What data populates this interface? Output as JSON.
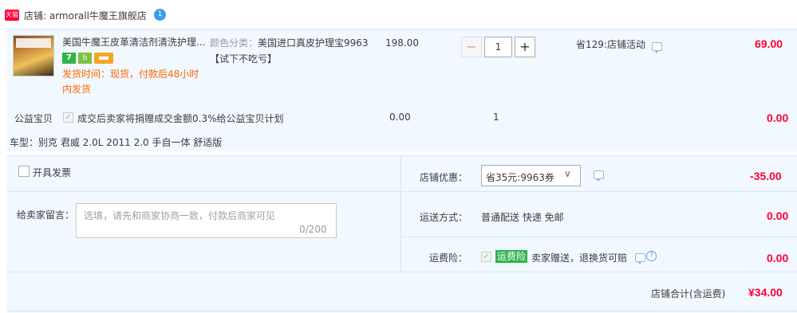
{
  "shop": {
    "badge": "天猫",
    "label": "店铺: armorall牛魔王旗舰店",
    "ww_icon_glyph": "1"
  },
  "item": {
    "title": "美国牛魔王皮革清洁剂清洗护理...",
    "badge_7": "7",
    "badge_b": "b",
    "delivery": "发货时间：现货，付款后48小时内发货",
    "sku_label": "颜色分类：",
    "sku_value": "美国进口真皮护理宝9963【试下不吃亏】",
    "unit_price": "198.00",
    "qty_minus": "−",
    "quantity": "1",
    "qty_plus": "+",
    "promo": "省129:店铺活动",
    "subtotal": "69.00"
  },
  "charity": {
    "label": "公益宝贝",
    "check_glyph": "✓",
    "text": "成交后卖家将捐赠成交金额0.3%给公益宝贝计划",
    "price": "0.00",
    "qty": "1",
    "subtotal": "0.00"
  },
  "car_model": "车型：别克 君威 2.0L 2011 2.0 手自一体 舒适版",
  "invoice": {
    "label": "开具发票"
  },
  "message": {
    "label": "给卖家留言：",
    "placeholder": "选填，请先和商家协商一致，付款后商家可见",
    "count": "0/200"
  },
  "coupon": {
    "label": "店铺优惠：",
    "selected": "省35元:9963券",
    "arrow": "∨",
    "amount": "-35.00"
  },
  "shipping": {
    "label": "运送方式：",
    "text": "普通配送 快递 免邮",
    "amount": "0.00"
  },
  "insurance": {
    "label": "运费险：",
    "check_glyph": "✓",
    "badge": "运费险",
    "text": "卖家赠送，退换货可赔",
    "help_glyph": "?",
    "amount": "0.00"
  },
  "total": {
    "label": "店铺合计(含运费)",
    "amount": "¥34.00"
  },
  "colors": {
    "accent_red": "#ff0036",
    "panel_bg": "#f1f8ff",
    "delivery_orange": "#ff6600",
    "insurance_green": "#2fb34c"
  }
}
